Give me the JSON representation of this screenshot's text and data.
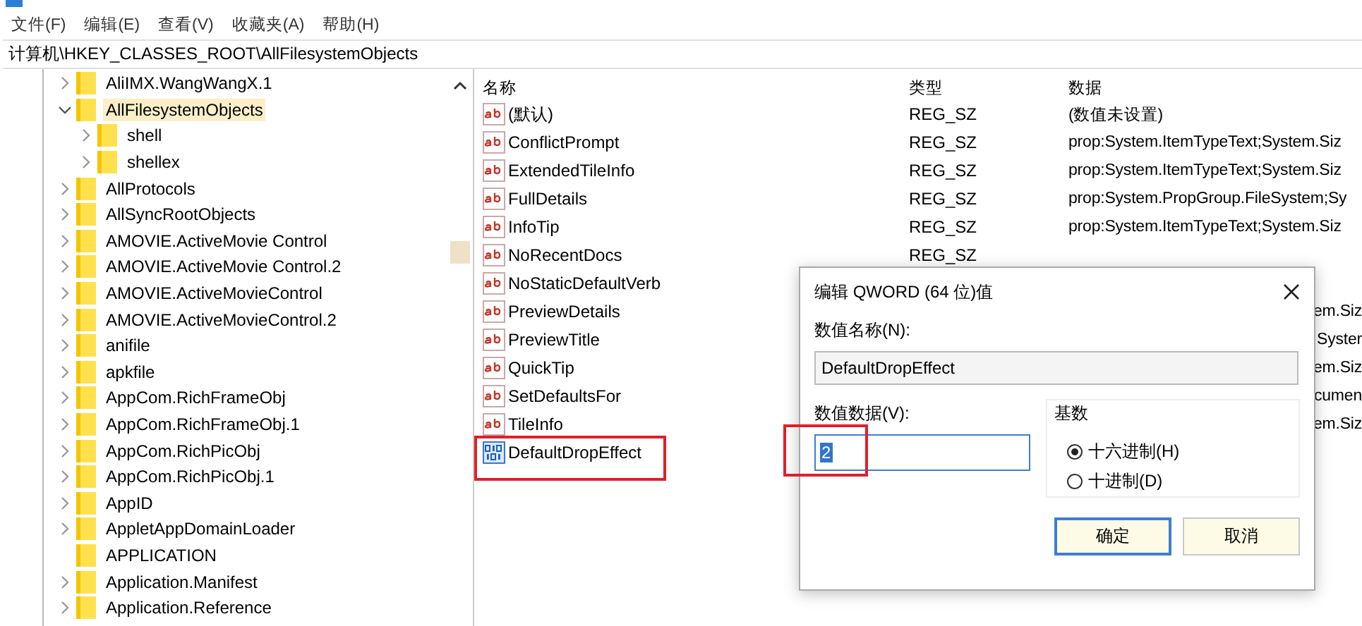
{
  "menu": [
    "文件(F)",
    "编辑(E)",
    "查看(V)",
    "收藏夹(A)",
    "帮助(H)"
  ],
  "address": "计算机\\HKEY_CLASSES_ROOT\\AllFilesystemObjects",
  "tree": [
    {
      "label": "AliIMX.WangWangX.1",
      "expanded": false,
      "selected": false,
      "has_children": true
    },
    {
      "label": "AllFilesystemObjects",
      "expanded": true,
      "selected": true,
      "has_children": true,
      "children": [
        {
          "label": "shell",
          "expanded": false,
          "selected": false,
          "has_children": true
        },
        {
          "label": "shellex",
          "expanded": false,
          "selected": false,
          "has_children": true
        }
      ]
    },
    {
      "label": "AllProtocols",
      "expanded": false,
      "selected": false,
      "has_children": true
    },
    {
      "label": "AllSyncRootObjects",
      "expanded": false,
      "selected": false,
      "has_children": true
    },
    {
      "label": "AMOVIE.ActiveMovie Control",
      "expanded": false,
      "selected": false,
      "has_children": true
    },
    {
      "label": "AMOVIE.ActiveMovie Control.2",
      "expanded": false,
      "selected": false,
      "has_children": true
    },
    {
      "label": "AMOVIE.ActiveMovieControl",
      "expanded": false,
      "selected": false,
      "has_children": true
    },
    {
      "label": "AMOVIE.ActiveMovieControl.2",
      "expanded": false,
      "selected": false,
      "has_children": true
    },
    {
      "label": "anifile",
      "expanded": false,
      "selected": false,
      "has_children": true
    },
    {
      "label": "apkfile",
      "expanded": false,
      "selected": false,
      "has_children": true
    },
    {
      "label": "AppCom.RichFrameObj",
      "expanded": false,
      "selected": false,
      "has_children": true
    },
    {
      "label": "AppCom.RichFrameObj.1",
      "expanded": false,
      "selected": false,
      "has_children": true
    },
    {
      "label": "AppCom.RichPicObj",
      "expanded": false,
      "selected": false,
      "has_children": true
    },
    {
      "label": "AppCom.RichPicObj.1",
      "expanded": false,
      "selected": false,
      "has_children": true
    },
    {
      "label": "AppID",
      "expanded": false,
      "selected": false,
      "has_children": true
    },
    {
      "label": "AppletAppDomainLoader",
      "expanded": false,
      "selected": false,
      "has_children": true
    },
    {
      "label": "APPLICATION",
      "selected": false,
      "has_children": false
    },
    {
      "label": "Application.Manifest",
      "expanded": false,
      "selected": false,
      "has_children": true
    },
    {
      "label": "Application.Reference",
      "expanded": false,
      "selected": false,
      "has_children": true
    }
  ],
  "table": {
    "columns": [
      "名称",
      "类型",
      "数据"
    ],
    "rows": [
      {
        "name": "(默认)",
        "kind": "string",
        "type": "REG_SZ",
        "data": "(数值未设置)"
      },
      {
        "name": "ConflictPrompt",
        "kind": "string",
        "type": "REG_SZ",
        "data": "prop:System.ItemTypeText;System.Siz"
      },
      {
        "name": "ExtendedTileInfo",
        "kind": "string",
        "type": "REG_SZ",
        "data": "prop:System.ItemTypeText;System.Siz"
      },
      {
        "name": "FullDetails",
        "kind": "string",
        "type": "REG_SZ",
        "data": "prop:System.PropGroup.FileSystem;Sy"
      },
      {
        "name": "InfoTip",
        "kind": "string",
        "type": "REG_SZ",
        "data": "prop:System.ItemTypeText;System.Siz"
      },
      {
        "name": "NoRecentDocs",
        "kind": "string",
        "type": "REG_SZ"
      },
      {
        "name": "NoStaticDefaultVerb",
        "kind": "string"
      },
      {
        "name": "PreviewDetails",
        "kind": "string",
        "data": "em.Siz"
      },
      {
        "name": "PreviewTitle",
        "kind": "string",
        "data": "Syster"
      },
      {
        "name": "QuickTip",
        "kind": "string",
        "data": "em.Siz"
      },
      {
        "name": "SetDefaultsFor",
        "kind": "string",
        "data": "cumen"
      },
      {
        "name": "TileInfo",
        "kind": "string",
        "data": "em.Siz"
      },
      {
        "name": "DefaultDropEffect",
        "kind": "binary"
      }
    ]
  },
  "dialog": {
    "title": "编辑 QWORD (64 位)值",
    "name_label": "数值名称(N):",
    "name_value": "DefaultDropEffect",
    "data_label": "数值数据(V):",
    "data_value": "2",
    "base_label": "基数",
    "bases": [
      {
        "label": "十六进制(H)",
        "selected": true
      },
      {
        "label": "十进制(D)",
        "selected": false
      }
    ],
    "buttons": [
      "确定",
      "取消"
    ]
  }
}
